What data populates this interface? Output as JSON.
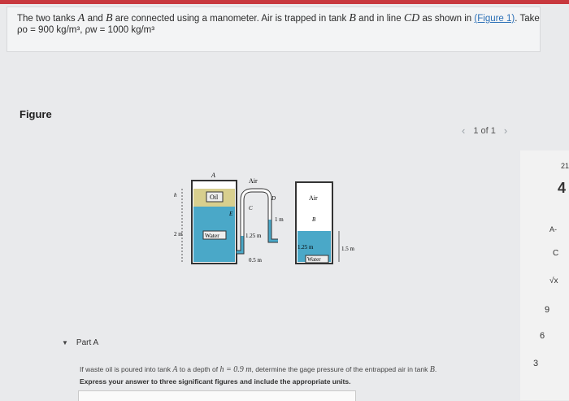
{
  "problem": {
    "line1_a": "The two tanks",
    "tank_a": "A",
    "and": "and",
    "tank_b": "B",
    "line1_b": "are connected using a manometer. Air is trapped in tank",
    "tank_b2": "B",
    "line1_c": "and in line",
    "line_cd": "CD",
    "line1_d": "as shown in",
    "figure_link": "(Figure 1)",
    "line1_e": "Take",
    "rho_o": "ρo = 900 kg/m³",
    "sep": ",",
    "rho_w": "ρw = 1000 kg/m³"
  },
  "figure": {
    "heading": "Figure",
    "pager": "1 of 1",
    "prev_icon": "chevron-left",
    "next_icon": "chevron-right",
    "labels": {
      "A": "A",
      "B": "B",
      "C": "C",
      "D": "D",
      "E": "E",
      "air_left": "Air",
      "air_right": "Air",
      "oil": "Oil",
      "water_left": "Water",
      "water_right": "Water",
      "h": "h",
      "two_m": "2 m",
      "one_m": "1 m",
      "one25_mid": "1.25 m",
      "one25_right": "1.25 m",
      "one5_m": "1.5 m",
      "zero5_m": "0.5 m"
    },
    "colors": {
      "water": "#4aa8c8",
      "oil": "#d8cf8e",
      "tank_bg": "#ffffff",
      "outline": "#333333"
    }
  },
  "right_edge": {
    "items": [
      "21",
      "4",
      "A-",
      "C",
      "√x",
      "9",
      "6",
      "3"
    ]
  },
  "part": {
    "label": "Part A",
    "caret_icon": "triangle-down",
    "q_a": "If waste oil is poured into tank",
    "q_tank": "A",
    "q_b": "to a depth of",
    "q_h": "h = 0.9 m",
    "q_c": ", determine the gage pressure of the entrapped air in tank",
    "q_tank_b": "B",
    "instructions": "Express your answer to three significant figures and include the appropriate units."
  }
}
